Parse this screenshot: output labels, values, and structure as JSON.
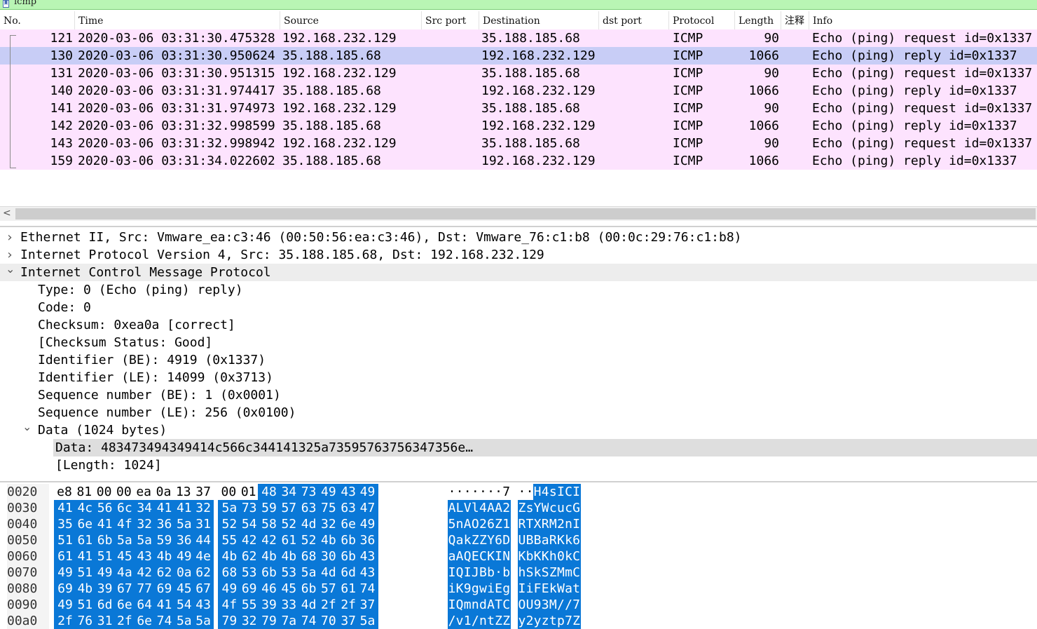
{
  "filter": {
    "text": "icmp",
    "bookmark_icon": "bookmark-icon"
  },
  "columns": [
    "No.",
    "Time",
    "Source",
    "Src port",
    "Destination",
    "dst port",
    "Protocol",
    "Length",
    "注释",
    "Info"
  ],
  "packets": [
    {
      "no": "121",
      "time": "2020-03-06 03:31:30.475328",
      "src": "192.168.232.129",
      "dst": "35.188.185.68",
      "proto": "ICMP",
      "len": "90",
      "info": "Echo (ping) request  id=0x1337"
    },
    {
      "no": "130",
      "time": "2020-03-06 03:31:30.950624",
      "src": "35.188.185.68",
      "dst": "192.168.232.129",
      "proto": "ICMP",
      "len": "1066",
      "info": "Echo (ping) reply    id=0x1337"
    },
    {
      "no": "131",
      "time": "2020-03-06 03:31:30.951315",
      "src": "192.168.232.129",
      "dst": "35.188.185.68",
      "proto": "ICMP",
      "len": "90",
      "info": "Echo (ping) request  id=0x1337"
    },
    {
      "no": "140",
      "time": "2020-03-06 03:31:31.974417",
      "src": "35.188.185.68",
      "dst": "192.168.232.129",
      "proto": "ICMP",
      "len": "1066",
      "info": "Echo (ping) reply    id=0x1337"
    },
    {
      "no": "141",
      "time": "2020-03-06 03:31:31.974973",
      "src": "192.168.232.129",
      "dst": "35.188.185.68",
      "proto": "ICMP",
      "len": "90",
      "info": "Echo (ping) request  id=0x1337"
    },
    {
      "no": "142",
      "time": "2020-03-06 03:31:32.998599",
      "src": "35.188.185.68",
      "dst": "192.168.232.129",
      "proto": "ICMP",
      "len": "1066",
      "info": "Echo (ping) reply    id=0x1337"
    },
    {
      "no": "143",
      "time": "2020-03-06 03:31:32.998942",
      "src": "192.168.232.129",
      "dst": "35.188.185.68",
      "proto": "ICMP",
      "len": "90",
      "info": "Echo (ping) request  id=0x1337"
    },
    {
      "no": "159",
      "time": "2020-03-06 03:31:34.022602",
      "src": "35.188.185.68",
      "dst": "192.168.232.129",
      "proto": "ICMP",
      "len": "1066",
      "info": "Echo (ping) reply    id=0x1337"
    }
  ],
  "selected_packet": "130",
  "colors": {
    "icmp_row": "#fde3fe",
    "selected_row": "#c8cdf6",
    "hex_highlight": "#0a78d7",
    "filter_ok": "#b9f5b4"
  },
  "details": [
    {
      "text": "Ethernet II, Src: Vmware_ea:c3:46 (00:50:56:ea:c3:46), Dst: Vmware_76:c1:b8 (00:0c:29:76:c1:b8)",
      "level": 0,
      "chev": "collapsed"
    },
    {
      "text": "Internet Protocol Version 4, Src: 35.188.185.68, Dst: 192.168.232.129",
      "level": 0,
      "chev": "collapsed"
    },
    {
      "text": "Internet Control Message Protocol",
      "level": 0,
      "chev": "expanded"
    },
    {
      "text": "Type: 0 (Echo (ping) reply)",
      "level": 1,
      "chev": ""
    },
    {
      "text": "Code: 0",
      "level": 1,
      "chev": ""
    },
    {
      "text": "Checksum: 0xea0a [correct]",
      "level": 1,
      "chev": ""
    },
    {
      "text": "[Checksum Status: Good]",
      "level": 1,
      "chev": ""
    },
    {
      "text": "Identifier (BE): 4919 (0x1337)",
      "level": 1,
      "chev": ""
    },
    {
      "text": "Identifier (LE): 14099 (0x3713)",
      "level": 1,
      "chev": ""
    },
    {
      "text": "Sequence number (BE): 1 (0x0001)",
      "level": 1,
      "chev": ""
    },
    {
      "text": "Sequence number (LE): 256 (0x0100)",
      "level": 1,
      "chev": ""
    },
    {
      "text": "Data (1024 bytes)",
      "level": 1,
      "chev": "expanded"
    },
    {
      "text": "Data: 483473494349414c566c344141325a73595763756347356e…",
      "level": 2,
      "chev": ""
    },
    {
      "text": "[Length: 1024]",
      "level": 2,
      "chev": ""
    }
  ],
  "hex": [
    {
      "offset": "0020",
      "bytes": [
        "e8",
        "81",
        "00",
        "00",
        "ea",
        "0a",
        "13",
        "37",
        "00",
        "01",
        "48",
        "34",
        "73",
        "49",
        "43",
        "49"
      ],
      "ascii": "·······7 ··H4sICI",
      "sel_from": 10
    },
    {
      "offset": "0030",
      "bytes": [
        "41",
        "4c",
        "56",
        "6c",
        "34",
        "41",
        "41",
        "32",
        "5a",
        "73",
        "59",
        "57",
        "63",
        "75",
        "63",
        "47"
      ],
      "ascii": "ALVl4AA2 ZsYWcucG",
      "sel_from": 0
    },
    {
      "offset": "0040",
      "bytes": [
        "35",
        "6e",
        "41",
        "4f",
        "32",
        "36",
        "5a",
        "31",
        "52",
        "54",
        "58",
        "52",
        "4d",
        "32",
        "6e",
        "49"
      ],
      "ascii": "5nAO26Z1 RTXRM2nI",
      "sel_from": 0
    },
    {
      "offset": "0050",
      "bytes": [
        "51",
        "61",
        "6b",
        "5a",
        "5a",
        "59",
        "36",
        "44",
        "55",
        "42",
        "42",
        "61",
        "52",
        "4b",
        "6b",
        "36"
      ],
      "ascii": "QakZZY6D UBBaRKk6",
      "sel_from": 0
    },
    {
      "offset": "0060",
      "bytes": [
        "61",
        "41",
        "51",
        "45",
        "43",
        "4b",
        "49",
        "4e",
        "4b",
        "62",
        "4b",
        "4b",
        "68",
        "30",
        "6b",
        "43"
      ],
      "ascii": "aAQECKIN KbKKh0kC",
      "sel_from": 0
    },
    {
      "offset": "0070",
      "bytes": [
        "49",
        "51",
        "49",
        "4a",
        "42",
        "62",
        "0a",
        "62",
        "68",
        "53",
        "6b",
        "53",
        "5a",
        "4d",
        "6d",
        "43"
      ],
      "ascii": "IQIJBb·b hSkSZMmC",
      "sel_from": 0
    },
    {
      "offset": "0080",
      "bytes": [
        "69",
        "4b",
        "39",
        "67",
        "77",
        "69",
        "45",
        "67",
        "49",
        "69",
        "46",
        "45",
        "6b",
        "57",
        "61",
        "74"
      ],
      "ascii": "iK9gwiEg IiFEkWat",
      "sel_from": 0
    },
    {
      "offset": "0090",
      "bytes": [
        "49",
        "51",
        "6d",
        "6e",
        "64",
        "41",
        "54",
        "43",
        "4f",
        "55",
        "39",
        "33",
        "4d",
        "2f",
        "2f",
        "37"
      ],
      "ascii": "IQmndATC OU93M//7",
      "sel_from": 0
    },
    {
      "offset": "00a0",
      "bytes": [
        "2f",
        "76",
        "31",
        "2f",
        "6e",
        "74",
        "5a",
        "5a",
        "79",
        "32",
        "79",
        "7a",
        "74",
        "70",
        "37",
        "5a"
      ],
      "ascii": "/v1/ntZZ y2yztp7Z",
      "sel_from": 0
    }
  ]
}
